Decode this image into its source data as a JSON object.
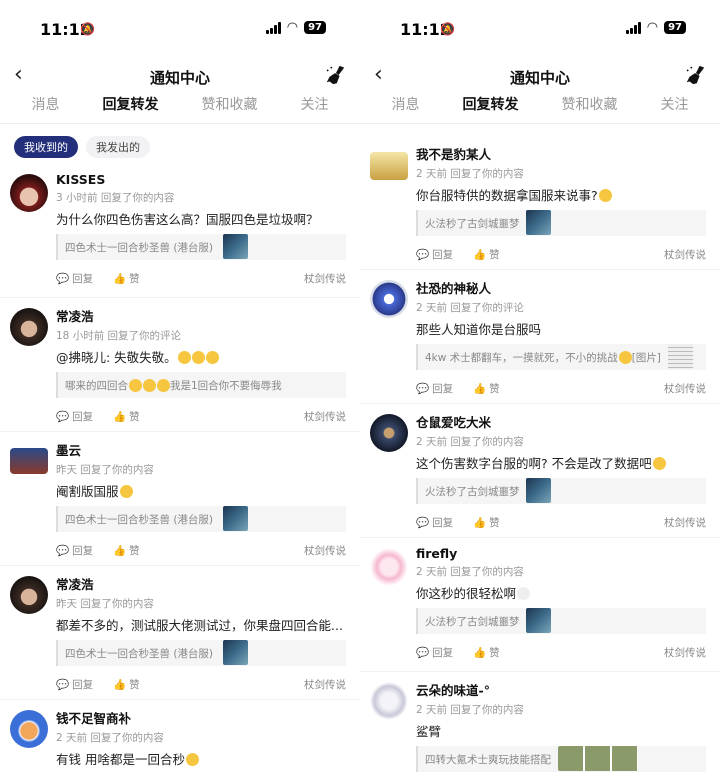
{
  "status": {
    "time": "11:12",
    "battery": "97"
  },
  "header": {
    "title": "通知中心"
  },
  "tabs": [
    "消息",
    "回复转发",
    "赞和收藏",
    "关注"
  ],
  "filters": [
    "我收到的",
    "我发出的"
  ],
  "actions": {
    "reply": "回复",
    "like": "赞"
  },
  "left_items": [
    {
      "name": "KISSES",
      "meta": "3 小时前 回复了你的内容",
      "body": "为什么你四色伤害这么高？国服四色是垃圾啊？",
      "quote": "四色术士一回合秒圣兽 (港台服)",
      "source": "杖剑传说"
    },
    {
      "name": "常凌浩",
      "meta": "18 小时前 回复了你的评论",
      "body": "@拂晓儿: 失敬失敬。",
      "quote": "哪来的四回合",
      "quote2": "我是1回合你不要侮辱我",
      "source": "杖剑传说"
    },
    {
      "name": "墨云",
      "meta": "昨天 回复了你的内容",
      "body": "阉割版国服",
      "quote": "四色术士一回合秒圣兽 (港台服)",
      "source": "杖剑传说"
    },
    {
      "name": "常凌浩",
      "meta": "昨天 回复了你的内容",
      "body": "都差不多的，测试服大佬测试过，你果盘四回合能...",
      "quote": "四色术士一回合秒圣兽 (港台服)",
      "source": "杖剑传说"
    },
    {
      "name": "钱不足智商补",
      "meta": "2 天前 回复了你的内容",
      "body": "有钱 用啥都是一回合秒"
    }
  ],
  "right_items": [
    {
      "name": "我不是豹某人",
      "meta": "2 天前 回复了你的内容",
      "body": "你台服特供的数据拿国服来说事?",
      "quote": "火法秒了古剑城噩梦",
      "source": "杖剑传说"
    },
    {
      "name": "社恐的神秘人",
      "meta": "2 天前 回复了你的评论",
      "body": "那些人知道你是台服吗",
      "quote": "4kw 术士都翻车，一摸就死，不小的挑战",
      "quote2": "[图片]",
      "source": "杖剑传说"
    },
    {
      "name": "仓鼠爱吃大米",
      "meta": "2 天前 回复了你的内容",
      "body": "这个伤害数字台服的啊? 不会是改了数据吧",
      "quote": "火法秒了古剑城噩梦",
      "source": "杖剑传说"
    },
    {
      "name": "firefly",
      "meta": "2 天前 回复了你的内容",
      "body": "你这秒的很轻松啊",
      "quote": "火法秒了古剑城噩梦",
      "source": "杖剑传说"
    },
    {
      "name": "云朵的味道-°",
      "meta": "2 天前 回复了你的内容",
      "body": "鲨臂",
      "quote": "四转大氪术士爽玩技能搭配"
    }
  ],
  "colors": {
    "accent": "#2bd4bd",
    "chip_active": "#232f7a"
  }
}
